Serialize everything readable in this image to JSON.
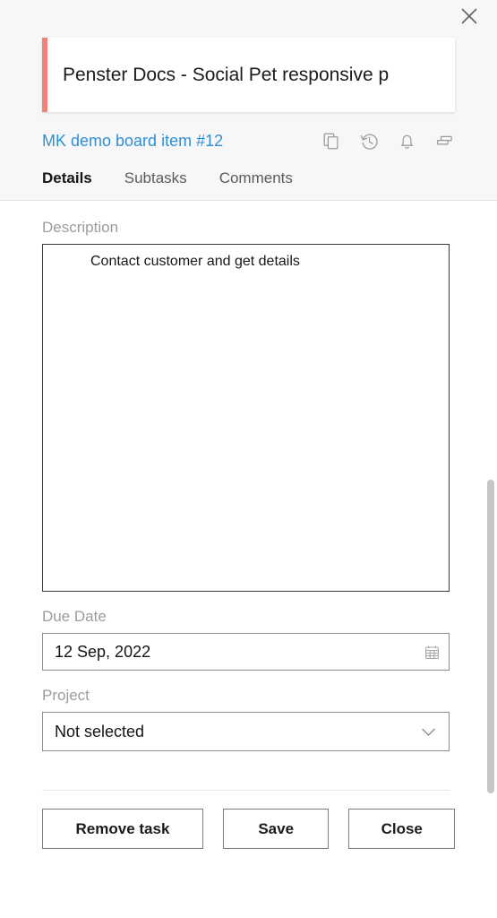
{
  "dialog": {
    "close_label": "×",
    "title_value": "Penster Docs - Social Pet responsive p",
    "board_link": "MK demo board item #12",
    "header_icons": [
      {
        "name": "copy-icon",
        "label": "Copy"
      },
      {
        "name": "history-icon",
        "label": "History"
      },
      {
        "name": "bell-icon",
        "label": "Notifications"
      },
      {
        "name": "cards-icon",
        "label": "Move to board"
      }
    ],
    "tabs": [
      {
        "label": "Details",
        "active": true
      },
      {
        "label": "Subtasks",
        "active": false
      },
      {
        "label": "Comments",
        "active": false
      }
    ]
  },
  "form": {
    "description": {
      "label": "Description",
      "value": "Contact customer and get details",
      "placeholder": ""
    },
    "due_date": {
      "label": "Due Date",
      "value": "12 Sep, 2022",
      "icon": "calendar-icon"
    },
    "project": {
      "label": "Project",
      "value": "Not selected",
      "icon": "chevron-down-icon",
      "options": [
        "Not selected"
      ]
    }
  },
  "footer": {
    "remove_label": "Remove task",
    "save_label": "Save",
    "close_label": "Close"
  },
  "colors": {
    "accent_bar": "#ef8379",
    "link": "#2f8fd4",
    "header_bg": "#f7f7f8",
    "label_text": "#9c9c9c",
    "scrollbar_thumb": "#c6c6c6"
  }
}
